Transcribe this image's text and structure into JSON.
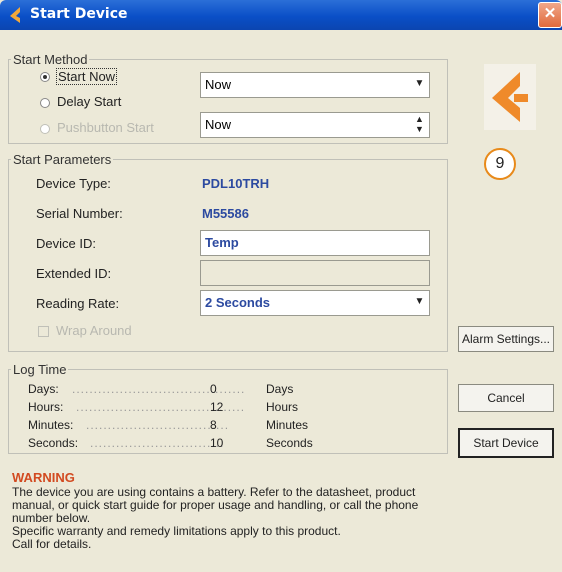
{
  "window": {
    "title": "Start Device",
    "close_glyph": "✕"
  },
  "start_method": {
    "legend": "Start Method",
    "options": [
      {
        "label": "Start Now",
        "selected": true,
        "enabled": true
      },
      {
        "label": "Delay Start",
        "selected": false,
        "enabled": true
      },
      {
        "label": "Pushbutton Start",
        "selected": false,
        "enabled": false
      }
    ],
    "delay_combo_value": "Now",
    "delay_spin_value": "Now"
  },
  "start_parameters": {
    "legend": "Start Parameters",
    "device_type_label": "Device Type:",
    "device_type_value": "PDL10TRH",
    "serial_label": "Serial Number:",
    "serial_value": "M55586",
    "device_id_label": "Device ID:",
    "device_id_value": "Temp",
    "extended_id_label": "Extended ID:",
    "extended_id_value": "",
    "reading_rate_label": "Reading Rate:",
    "reading_rate_value": "2 Seconds",
    "wrap_label": "Wrap Around"
  },
  "log_time": {
    "legend": "Log Time",
    "rows": [
      {
        "label": "Days:",
        "value": "0",
        "unit": "Days"
      },
      {
        "label": "Hours:",
        "value": "12",
        "unit": "Hours"
      },
      {
        "label": "Minutes:",
        "value": "8",
        "unit": "Minutes"
      },
      {
        "label": "Seconds:",
        "value": "10",
        "unit": "Seconds"
      }
    ]
  },
  "warning": {
    "title": "WARNING",
    "text": "The device you are using contains a battery. Refer to the datasheet, product manual, or quick start guide for proper usage and handling, or call the phone number below.",
    "text2": "Specific warranty and remedy limitations apply to this product.",
    "text3": "Call  for details."
  },
  "buttons": {
    "alarm": "Alarm Settings...",
    "cancel": "Cancel",
    "start": "Start Device"
  },
  "badge_number": "9",
  "colors": {
    "accent": "#e88a1a",
    "value_blue": "#2c4aa0",
    "warning": "#d24a20",
    "title_bar": "#0a4fc7"
  }
}
